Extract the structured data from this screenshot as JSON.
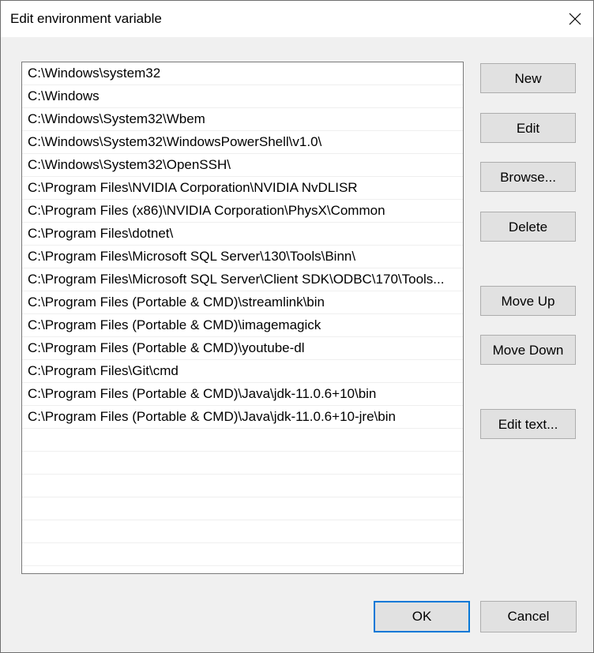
{
  "window": {
    "title": "Edit environment variable"
  },
  "paths": [
    "C:\\Windows\\system32",
    "C:\\Windows",
    "C:\\Windows\\System32\\Wbem",
    "C:\\Windows\\System32\\WindowsPowerShell\\v1.0\\",
    "C:\\Windows\\System32\\OpenSSH\\",
    "C:\\Program Files\\NVIDIA Corporation\\NVIDIA NvDLISR",
    "C:\\Program Files (x86)\\NVIDIA Corporation\\PhysX\\Common",
    "C:\\Program Files\\dotnet\\",
    "C:\\Program Files\\Microsoft SQL Server\\130\\Tools\\Binn\\",
    "C:\\Program Files\\Microsoft SQL Server\\Client SDK\\ODBC\\170\\Tools...",
    "C:\\Program Files (Portable & CMD)\\streamlink\\bin",
    "C:\\Program Files (Portable & CMD)\\imagemagick",
    "C:\\Program Files (Portable & CMD)\\youtube-dl",
    "C:\\Program Files\\Git\\cmd",
    "C:\\Program Files (Portable & CMD)\\Java\\jdk-11.0.6+10\\bin",
    "C:\\Program Files (Portable & CMD)\\Java\\jdk-11.0.6+10-jre\\bin"
  ],
  "buttons": {
    "new": "New",
    "edit": "Edit",
    "browse": "Browse...",
    "delete": "Delete",
    "move_up": "Move Up",
    "move_down": "Move Down",
    "edit_text": "Edit text...",
    "ok": "OK",
    "cancel": "Cancel"
  },
  "icons": {
    "close": "close-icon"
  }
}
